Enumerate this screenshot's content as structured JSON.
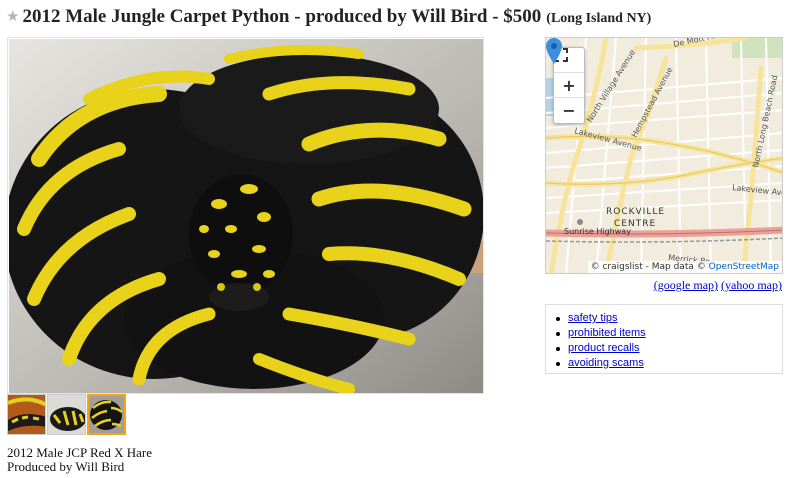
{
  "post": {
    "title": "2012 Male Jungle Carpet Python - produced by Will Bird - $500",
    "location": "(Long Island NY)",
    "favorite_icon": "star-icon",
    "description_lines": [
      "2012 Male JCP Red X Hare",
      "Produced by Will Bird"
    ]
  },
  "images": {
    "main_alt": "black and yellow jungle carpet python",
    "thumbnail_count": 3,
    "selected_thumbnail": 3
  },
  "map": {
    "controls": {
      "fullscreen_icon": "fullscreen-icon",
      "zoom_in": "+",
      "zoom_out": "−"
    },
    "labels": {
      "de_mott": "De Mott Avenue",
      "north_village": "North Village Avenue",
      "hempstead": "Hempstead Avenue",
      "lakeview_w": "Lakeview Avenue",
      "lakeview_e": "Lakeview Avenue",
      "north_long_beach": "North Long Beach Road",
      "rockville": "ROCKVILLE",
      "centre": "CENTRE",
      "sunrise": "Sunrise Highway",
      "merrick": "Merrick Ro"
    },
    "attribution_prefix": "© craigslist - Map data ©",
    "attribution_link": "OpenStreetMap",
    "pin_icon": "location-pin-icon"
  },
  "map_links": {
    "google": "(google map)",
    "yahoo": "(yahoo map)"
  },
  "safety_links": [
    "safety tips",
    "prohibited items",
    "product recalls",
    "avoiding scams"
  ],
  "colors": {
    "accent_thumb_border": "#f4a41a",
    "link": "#0000cc",
    "pin": "#3b8ee0"
  }
}
